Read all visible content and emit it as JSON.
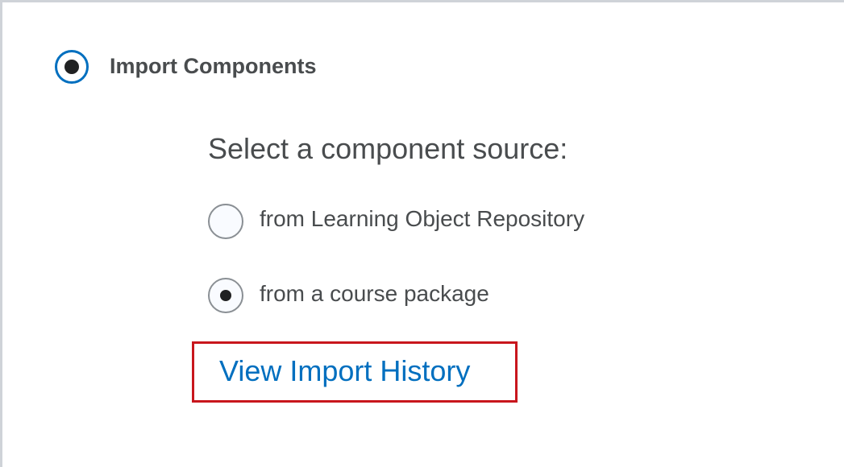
{
  "import_option": {
    "label": "Import Components",
    "selected": true
  },
  "component_source": {
    "prompt": "Select a component source:",
    "options": [
      {
        "label": "from Learning Object Repository",
        "selected": false
      },
      {
        "label": "from a course package",
        "selected": true
      }
    ]
  },
  "history_link": {
    "label": "View Import History"
  },
  "colors": {
    "accent": "#006fbf",
    "text": "#494c4e",
    "highlight_border": "#c8161d",
    "frame_border": "#cfd3d8"
  }
}
